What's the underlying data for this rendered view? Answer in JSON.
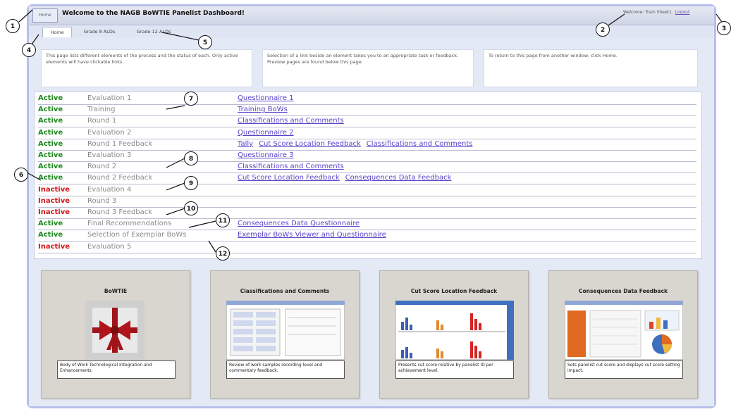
{
  "header": {
    "home_button": "Home",
    "title": "Welcome to the NAGB BoWTIE Panelist Dashboard!",
    "welcome_text": "Welcome: Train Sheet1",
    "logout_label": "Logout"
  },
  "tabs": [
    {
      "label": "Home"
    },
    {
      "label": "Grade 8 ALDs"
    },
    {
      "label": "Grade 12 ALDs"
    }
  ],
  "intro": [
    "This page lists different elements of the process and the status of each. Only active elements will have clickable links.",
    "Selection of a link beside an element takes you to an appropriate task or feedback. Preview pages are found below this page.",
    "To return to this page from another window, click Home."
  ],
  "rows": [
    {
      "status": "Active",
      "element": "Evaluation 1",
      "links": [
        "Questionnaire 1"
      ]
    },
    {
      "status": "Active",
      "element": "Training",
      "links": [
        "Training BoWs"
      ]
    },
    {
      "status": "Active",
      "element": "Round 1",
      "links": [
        "Classifications and Comments"
      ]
    },
    {
      "status": "Active",
      "element": "Evaluation 2",
      "links": [
        "Questionnaire 2"
      ]
    },
    {
      "status": "Active",
      "element": "Round 1 Feedback",
      "links": [
        "Tally",
        "Cut Score Location Feedback",
        "Classifications and Comments"
      ]
    },
    {
      "status": "Active",
      "element": "Evaluation 3",
      "links": [
        "Questionnaire 3"
      ]
    },
    {
      "status": "Active",
      "element": "Round 2",
      "links": [
        "Classifications and Comments"
      ]
    },
    {
      "status": "Active",
      "element": "Round 2 Feedback",
      "links": [
        "Cut Score Location Feedback",
        "Consequences Data Feedback"
      ]
    },
    {
      "status": "Inactive",
      "element": "Evaluation 4",
      "links": []
    },
    {
      "status": "Inactive",
      "element": "Round 3",
      "links": []
    },
    {
      "status": "Inactive",
      "element": "Round 3 Feedback",
      "links": []
    },
    {
      "status": "Active",
      "element": "Final Recommendations",
      "links": [
        "Consequences Data Questionnaire"
      ]
    },
    {
      "status": "Active",
      "element": "Selection of Exemplar BoWs",
      "links": [
        "Exemplar BoWs Viewer and Questionnaire"
      ]
    },
    {
      "status": "Inactive",
      "element": "Evaluation 5",
      "links": []
    }
  ],
  "cards": [
    {
      "title": "BoWTIE",
      "desc": "Body of Work Technological Integration and Enhancements."
    },
    {
      "title": "Classifications and Comments",
      "desc": "Review of work samples recording level and commentary feedback."
    },
    {
      "title": "Cut Score Location Feedback",
      "desc": "Presents cut score relative by panelist ID per achievement level."
    },
    {
      "title": "Consequences Data Feedback",
      "desc": "Sets panelist cut score and displays cut score setting impact."
    }
  ],
  "callouts": [
    "1",
    "2",
    "3",
    "4",
    "5",
    "6",
    "7",
    "8",
    "9",
    "10",
    "11",
    "12"
  ],
  "colors": {
    "active": "#1c8a1c",
    "inactive": "#d21515",
    "link": "#5b42c8"
  }
}
